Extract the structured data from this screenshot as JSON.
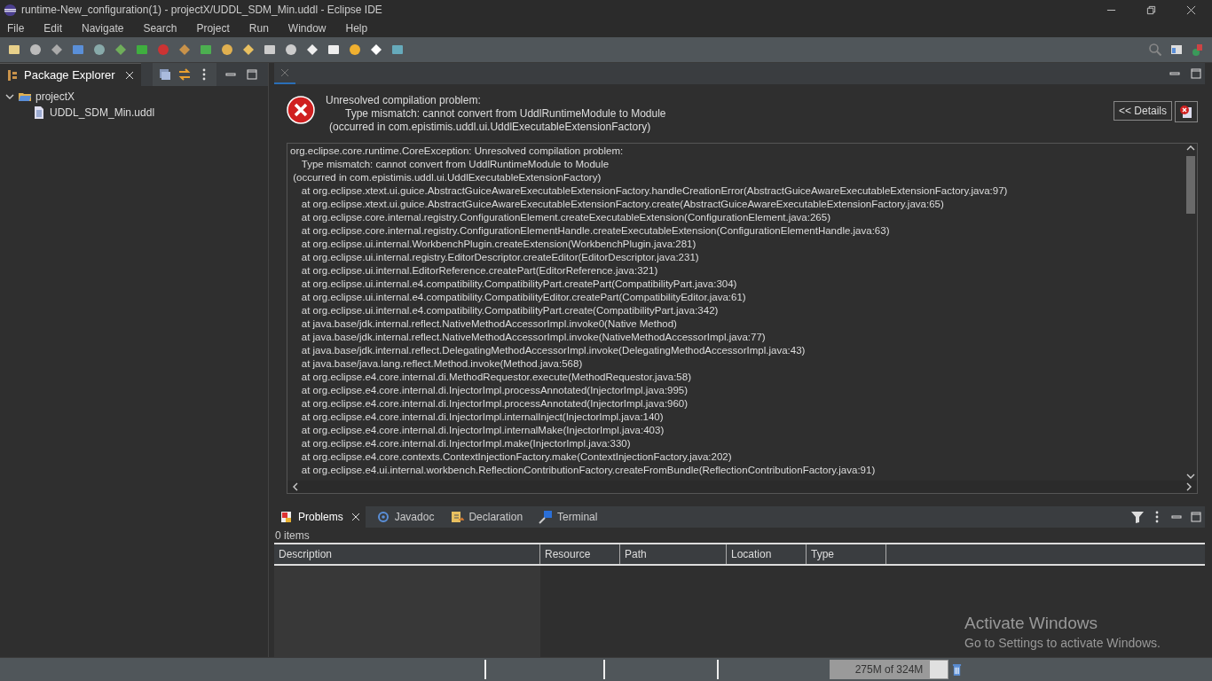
{
  "window": {
    "title": "runtime-New_configuration(1) - projectX/UDDL_SDM_Min.uddl - Eclipse IDE"
  },
  "menu": [
    "File",
    "Edit",
    "Navigate",
    "Search",
    "Project",
    "Run",
    "Window",
    "Help"
  ],
  "package_explorer": {
    "tab": "Package Explorer",
    "tree": [
      {
        "label": "projectX",
        "expanded": true,
        "children": [
          {
            "label": "UDDL_SDM_Min.uddl"
          }
        ]
      }
    ]
  },
  "error": {
    "title": "Unresolved compilation problem:",
    "message": "Type mismatch: cannot convert from UddlRuntimeModule to Module",
    "origin": "(occurred in com.epistimis.uddl.ui.UddlExecutableExtensionFactory)",
    "details_button": "<< Details"
  },
  "stack_trace": [
    "org.eclipse.core.runtime.CoreException: Unresolved compilation problem:",
    "\tType mismatch: cannot convert from UddlRuntimeModule to Module",
    " (occurred in com.epistimis.uddl.ui.UddlExecutableExtensionFactory)",
    "\tat org.eclipse.xtext.ui.guice.AbstractGuiceAwareExecutableExtensionFactory.handleCreationError(AbstractGuiceAwareExecutableExtensionFactory.java:97)",
    "\tat org.eclipse.xtext.ui.guice.AbstractGuiceAwareExecutableExtensionFactory.create(AbstractGuiceAwareExecutableExtensionFactory.java:65)",
    "\tat org.eclipse.core.internal.registry.ConfigurationElement.createExecutableExtension(ConfigurationElement.java:265)",
    "\tat org.eclipse.core.internal.registry.ConfigurationElementHandle.createExecutableExtension(ConfigurationElementHandle.java:63)",
    "\tat org.eclipse.ui.internal.WorkbenchPlugin.createExtension(WorkbenchPlugin.java:281)",
    "\tat org.eclipse.ui.internal.registry.EditorDescriptor.createEditor(EditorDescriptor.java:231)",
    "\tat org.eclipse.ui.internal.EditorReference.createPart(EditorReference.java:321)",
    "\tat org.eclipse.ui.internal.e4.compatibility.CompatibilityPart.createPart(CompatibilityPart.java:304)",
    "\tat org.eclipse.ui.internal.e4.compatibility.CompatibilityEditor.createPart(CompatibilityEditor.java:61)",
    "\tat org.eclipse.ui.internal.e4.compatibility.CompatibilityPart.create(CompatibilityPart.java:342)",
    "\tat java.base/jdk.internal.reflect.NativeMethodAccessorImpl.invoke0(Native Method)",
    "\tat java.base/jdk.internal.reflect.NativeMethodAccessorImpl.invoke(NativeMethodAccessorImpl.java:77)",
    "\tat java.base/jdk.internal.reflect.DelegatingMethodAccessorImpl.invoke(DelegatingMethodAccessorImpl.java:43)",
    "\tat java.base/java.lang.reflect.Method.invoke(Method.java:568)",
    "\tat org.eclipse.e4.core.internal.di.MethodRequestor.execute(MethodRequestor.java:58)",
    "\tat org.eclipse.e4.core.internal.di.InjectorImpl.processAnnotated(InjectorImpl.java:995)",
    "\tat org.eclipse.e4.core.internal.di.InjectorImpl.processAnnotated(InjectorImpl.java:960)",
    "\tat org.eclipse.e4.core.internal.di.InjectorImpl.internalInject(InjectorImpl.java:140)",
    "\tat org.eclipse.e4.core.internal.di.InjectorImpl.internalMake(InjectorImpl.java:403)",
    "\tat org.eclipse.e4.core.internal.di.InjectorImpl.make(InjectorImpl.java:330)",
    "\tat org.eclipse.e4.core.contexts.ContextInjectionFactory.make(ContextInjectionFactory.java:202)",
    "\tat org.eclipse.e4.ui.internal.workbench.ReflectionContributionFactory.createFromBundle(ReflectionContributionFactory.java:91)"
  ],
  "bottom_tabs": [
    {
      "label": "Problems",
      "selected": true
    },
    {
      "label": "Javadoc",
      "selected": false
    },
    {
      "label": "Declaration",
      "selected": false
    },
    {
      "label": "Terminal",
      "selected": false
    }
  ],
  "problems": {
    "count": "0 items",
    "columns": [
      "Description",
      "Resource",
      "Path",
      "Location",
      "Type"
    ]
  },
  "status_bar": {
    "memory": "275M of 324M",
    "level": 0.85
  },
  "activation_notice": {
    "title": "Activate Windows",
    "hint": "Go to Settings to activate Windows."
  }
}
